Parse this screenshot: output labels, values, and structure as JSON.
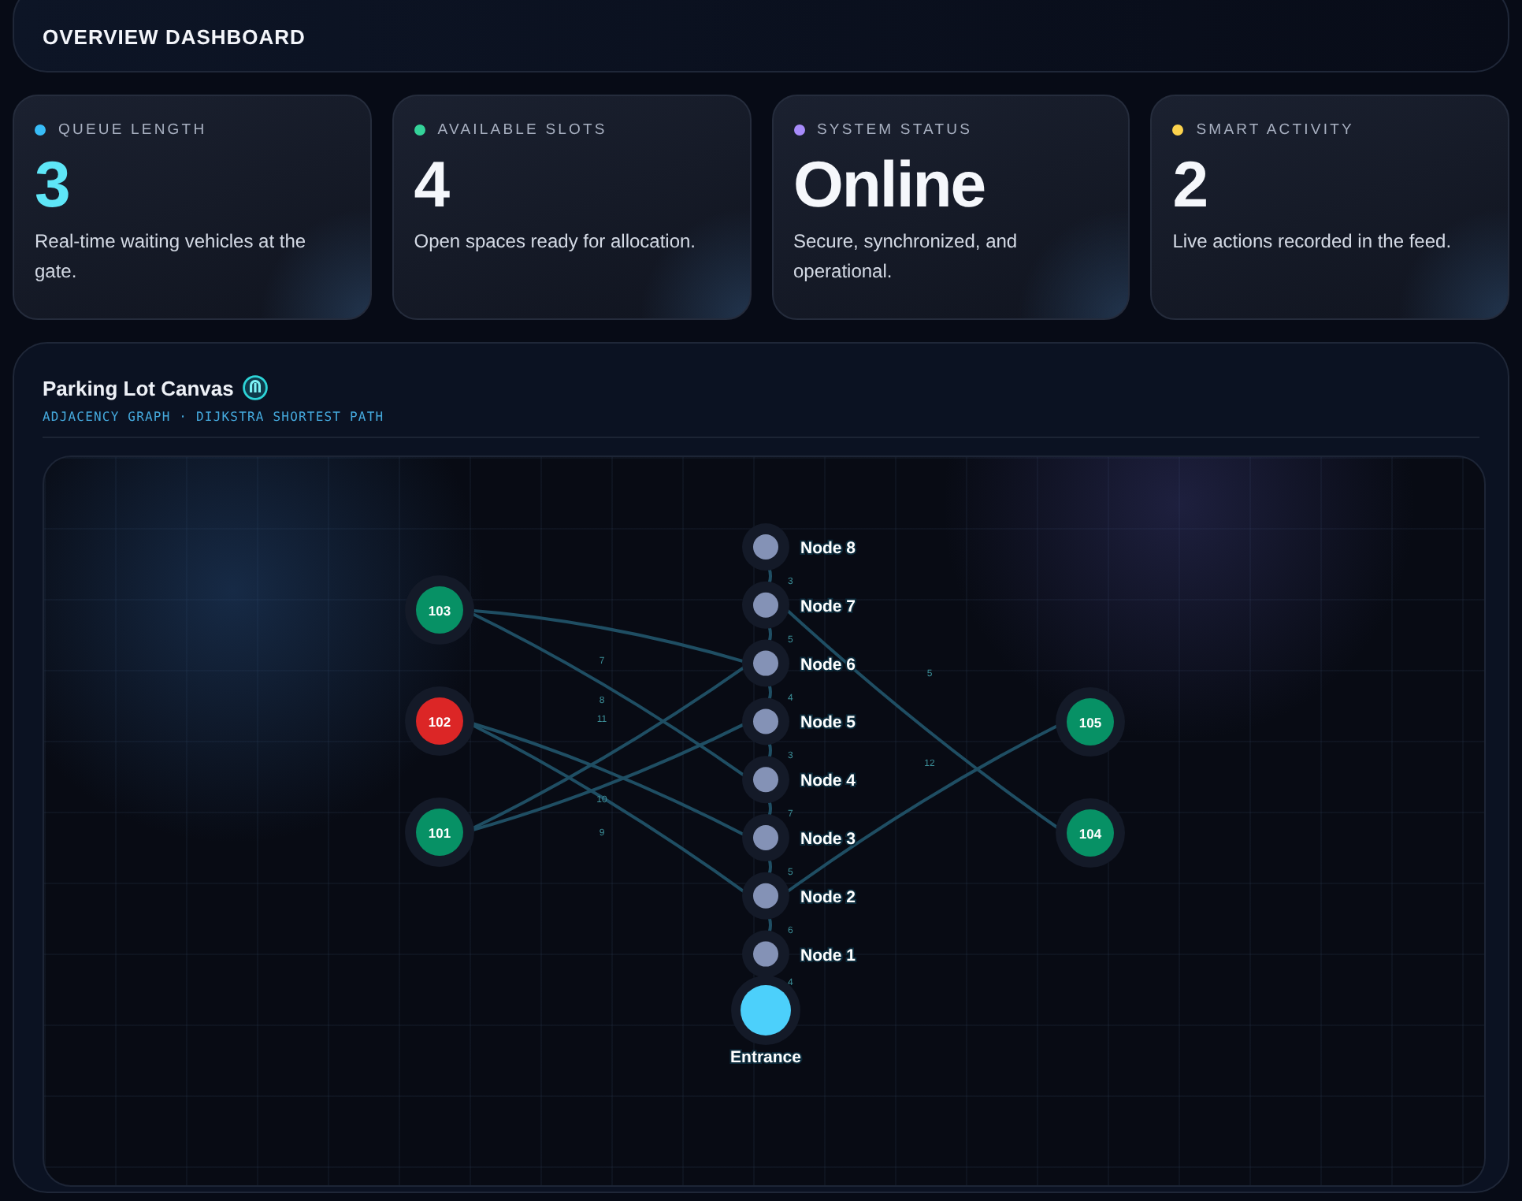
{
  "header": {
    "title": "OVERVIEW DASHBOARD"
  },
  "cards": [
    {
      "label": "QUEUE LENGTH",
      "color": "#38bdf8",
      "value": "3",
      "highlight": true,
      "description": "Real-time waiting vehicles at the gate."
    },
    {
      "label": "AVAILABLE SLOTS",
      "color": "#34d399",
      "value": "4",
      "highlight": false,
      "description": "Open spaces ready for allocation."
    },
    {
      "label": "SYSTEM STATUS",
      "color": "#a78bfa",
      "value": "Online",
      "highlight": false,
      "description": "Secure, synchronized, and operational."
    },
    {
      "label": "SMART ACTIVITY",
      "color": "#fcd34d",
      "value": "2",
      "highlight": false,
      "description": "Live actions recorded in the feed."
    }
  ],
  "panel": {
    "title": "Parking Lot Canvas",
    "subtitle": "ADJACENCY GRAPH · DIJKSTRA SHORTEST PATH",
    "path_nodes": [
      "Node 8",
      "Node 7",
      "Node 6",
      "Node 5",
      "Node 4",
      "Node 3",
      "Node 2",
      "Node 1"
    ],
    "entrance": "Entrance",
    "chain_weights": [
      "3",
      "5",
      "4",
      "3",
      "7",
      "5",
      "6",
      "4"
    ],
    "slots": [
      {
        "label": "103",
        "occupied": false
      },
      {
        "label": "102",
        "occupied": true
      },
      {
        "label": "101",
        "occupied": false
      },
      {
        "label": "105",
        "occupied": false
      },
      {
        "label": "104",
        "occupied": false
      }
    ],
    "link_weights": [
      "7",
      "8",
      "11",
      "10",
      "9",
      "5",
      "12"
    ]
  }
}
